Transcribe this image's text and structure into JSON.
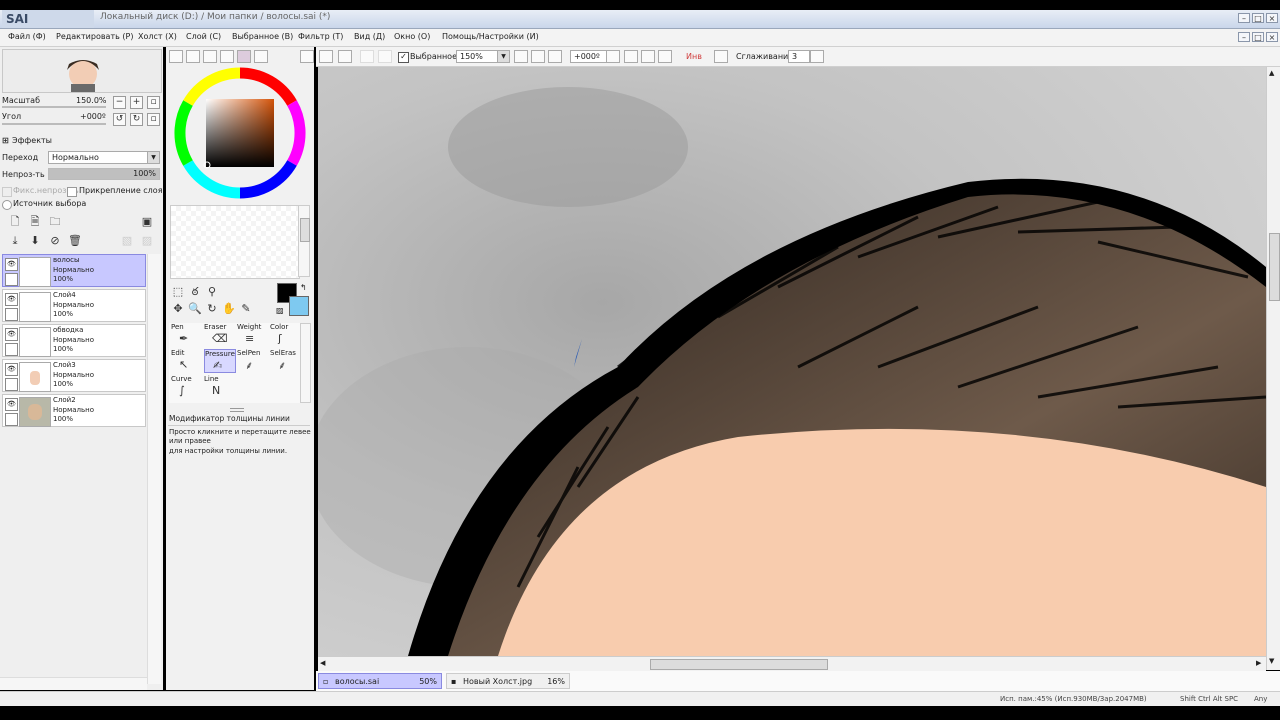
{
  "window": {
    "logo_text": "SAI",
    "title": "Локальный диск (D:) / Мои папки / волосы.sai (*)"
  },
  "menu": [
    {
      "label": "Файл (Ф)"
    },
    {
      "label": "Редактировать (Р)"
    },
    {
      "label": "Холст (Х)"
    },
    {
      "label": "Слой (С)"
    },
    {
      "label": "Выбранное (В)"
    },
    {
      "label": "Фильтр (Т)"
    },
    {
      "label": "Вид (Д)"
    },
    {
      "label": "Окно (О)"
    },
    {
      "label": "Помощь/Настройки (И)"
    }
  ],
  "navigator": {
    "zoom_label": "Масштаб",
    "zoom_value": "150.0%",
    "angle_label": "Угол",
    "angle_value": "+000º"
  },
  "effects": {
    "header": "Эффекты",
    "blend_label": "Переход",
    "blend_value": "Нормально",
    "opacity_label": "Непроз-ть",
    "opacity_value": "100%",
    "opacity_fraction": 1.0,
    "preserve_label": "Фикс.непроз-ть",
    "clip_label": "Прикрепление слоя",
    "source_label": "Источник выбора"
  },
  "layers": [
    {
      "name": "волосы",
      "mode": "Нормально",
      "opacity": "100%",
      "selected": true
    },
    {
      "name": "Слой4",
      "mode": "Нормально",
      "opacity": "100%",
      "selected": false
    },
    {
      "name": "обводка",
      "mode": "Нормально",
      "opacity": "100%",
      "selected": false
    },
    {
      "name": "Слой3",
      "mode": "Нормально",
      "opacity": "100%",
      "selected": false
    },
    {
      "name": "Слой2",
      "mode": "Нормально",
      "opacity": "100%",
      "selected": false
    }
  ],
  "brushes": {
    "row1": [
      "Pen",
      "Eraser",
      "Weight",
      "Color"
    ],
    "row2": [
      "Edit",
      "Pressure",
      "SelPen",
      "SelEras"
    ],
    "row3": [
      "Curve",
      "Line"
    ],
    "selected": "Pressure"
  },
  "help": {
    "title": "Модификатор толщины линии",
    "line1": "Просто кликните и перетащите левее",
    "line2": "или правее",
    "line3": "для настройки толщины линии."
  },
  "canvas_toolbar": {
    "selection_label": "Выбранное",
    "zoom_value": "150%",
    "angle_value": "+000º",
    "invert_label": "Инв",
    "smoothing_label": "Сглаживание",
    "smoothing_value": "3"
  },
  "colors": {
    "primary": "#000000",
    "secondary": "#7ec9f0",
    "skin": "#f8ccae",
    "hair_light": "#7a6656",
    "selected_layer": "#c8c8ff"
  },
  "tabs": [
    {
      "name": "волосы.sai",
      "zoom": "50%",
      "active": true
    },
    {
      "name": "Новый Холст.jpg",
      "zoom": "16%",
      "active": false
    }
  ],
  "status": {
    "memory": "Исп. пам.:45% (Исп.930MB/Зар.2047MB)",
    "keys": "Shift Ctrl Alt SPC",
    "app": "Any"
  }
}
